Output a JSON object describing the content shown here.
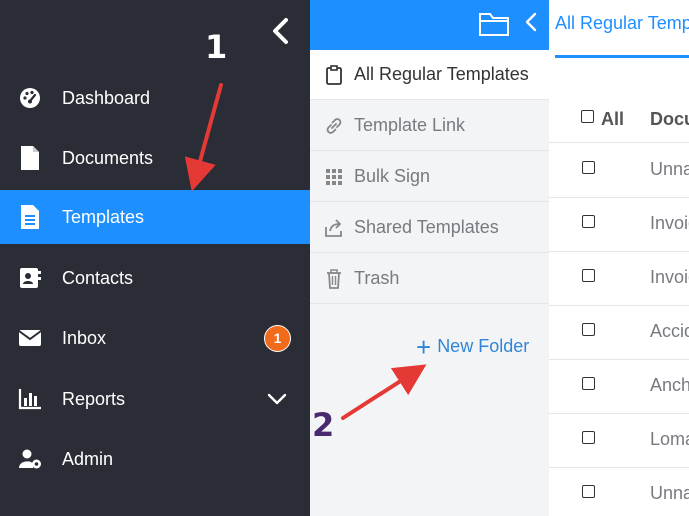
{
  "nav": {
    "items": [
      {
        "label": "Dashboard",
        "icon": "dashboard-gauge-icon"
      },
      {
        "label": "Documents",
        "icon": "document-icon"
      },
      {
        "label": "Templates",
        "icon": "template-icon",
        "active": true
      },
      {
        "label": "Contacts",
        "icon": "contact-card-icon"
      },
      {
        "label": "Inbox",
        "icon": "envelope-icon",
        "badge": "1"
      },
      {
        "label": "Reports",
        "icon": "bar-chart-icon",
        "expandable": true
      },
      {
        "label": "Admin",
        "icon": "user-gear-icon"
      }
    ]
  },
  "panel": {
    "items": [
      {
        "label": "All Regular Templates",
        "icon": "clipboard-icon",
        "active": true
      },
      {
        "label": "Template Link",
        "icon": "link-icon"
      },
      {
        "label": "Bulk Sign",
        "icon": "grid-icon"
      },
      {
        "label": "Shared Templates",
        "icon": "share-icon"
      },
      {
        "label": "Trash",
        "icon": "trash-icon"
      }
    ],
    "new_folder": "New Folder"
  },
  "content": {
    "tab_label": "All Regular Templates",
    "header": {
      "all": "All",
      "document": "Document"
    },
    "rows": [
      "Unnamed",
      "Invoice",
      "Invoice",
      "Accident",
      "Anchor",
      "Loma",
      "Unnamed"
    ]
  },
  "annotations": {
    "step1": "1",
    "step2": "2"
  },
  "colors": {
    "nav_bg": "#2b2d36",
    "accent": "#1e8fff",
    "badge": "#f26a1b",
    "annotation_arrow": "#e53935",
    "step2_text": "#4a2a6e"
  }
}
